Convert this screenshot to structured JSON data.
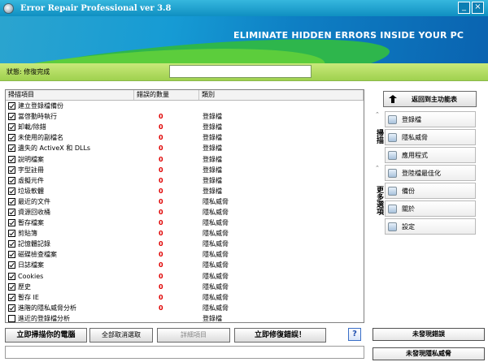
{
  "window": {
    "title": "Error Repair Professional ver 3.8",
    "minimize_label": "_",
    "close_label": "×"
  },
  "banner": {
    "tagline": "ELIMINATE HIDDEN ERRORS INSIDE YOUR PC"
  },
  "status": {
    "label": "狀態: 修復完成",
    "value": ""
  },
  "scan_list": {
    "columns": [
      "掃描項目",
      "錯誤的數量",
      "類別"
    ],
    "rows": [
      {
        "label": "建立登錄檔備份",
        "checked": true,
        "count": "",
        "type": ""
      },
      {
        "label": "當啓動時執行",
        "checked": true,
        "count": "0",
        "type": "登錄檔"
      },
      {
        "label": "卸載/除錯",
        "checked": true,
        "count": "0",
        "type": "登錄檔"
      },
      {
        "label": "未使用的副檔名",
        "checked": true,
        "count": "0",
        "type": "登錄檔"
      },
      {
        "label": "遺失的 ActiveX 和 DLLs",
        "checked": true,
        "count": "0",
        "type": "登錄檔"
      },
      {
        "label": "說明檔案",
        "checked": true,
        "count": "0",
        "type": "登錄檔"
      },
      {
        "label": "字型註冊",
        "checked": true,
        "count": "0",
        "type": "登錄檔"
      },
      {
        "label": "虛擬元件",
        "checked": true,
        "count": "0",
        "type": "登錄檔"
      },
      {
        "label": "垃圾軟體",
        "checked": true,
        "count": "0",
        "type": "登錄檔"
      },
      {
        "label": "最近的文件",
        "checked": true,
        "count": "0",
        "type": "隱私威脅"
      },
      {
        "label": "資源回收桶",
        "checked": true,
        "count": "0",
        "type": "隱私威脅"
      },
      {
        "label": "暫存檔案",
        "checked": true,
        "count": "0",
        "type": "隱私威脅"
      },
      {
        "label": "剪貼簿",
        "checked": true,
        "count": "0",
        "type": "隱私威脅"
      },
      {
        "label": "記憶體記錄",
        "checked": true,
        "count": "0",
        "type": "隱私威脅"
      },
      {
        "label": "磁碟檢查檔案",
        "checked": true,
        "count": "0",
        "type": "隱私威脅"
      },
      {
        "label": "日誌檔案",
        "checked": true,
        "count": "0",
        "type": "隱私威脅"
      },
      {
        "label": "Cookies",
        "checked": true,
        "count": "0",
        "type": "隱私威脅"
      },
      {
        "label": "歷史",
        "checked": true,
        "count": "0",
        "type": "隱私威脅"
      },
      {
        "label": "暫存 IE",
        "checked": true,
        "count": "0",
        "type": "隱私威脅"
      },
      {
        "label": "進階的隱私威脅分析",
        "checked": true,
        "count": "0",
        "type": "隱私威脅"
      },
      {
        "label": "進近的登錄檔分析",
        "checked": false,
        "count": "",
        "type": "登錄檔"
      }
    ]
  },
  "buttons": {
    "scan": "立即掃描你的電腦",
    "uncheck_all": "全部取消選取",
    "details": "詳細項目",
    "repair": "立即修復錯誤！",
    "help": "?"
  },
  "sidebar": {
    "back": "返回到主功能表",
    "scan_group_title": "掃描",
    "scan_items": [
      "登錄檔",
      "隱私威脅",
      "應用程式"
    ],
    "more_group_title": "更多選項",
    "more_items": [
      "登陸檔最佳化",
      "備份",
      "關於",
      "設定"
    ],
    "collapse_icon": "chevron-up-icon"
  },
  "right_buttons": {
    "no_errors": "未發現錯誤",
    "no_privacy": "未發現隱私威脅"
  }
}
